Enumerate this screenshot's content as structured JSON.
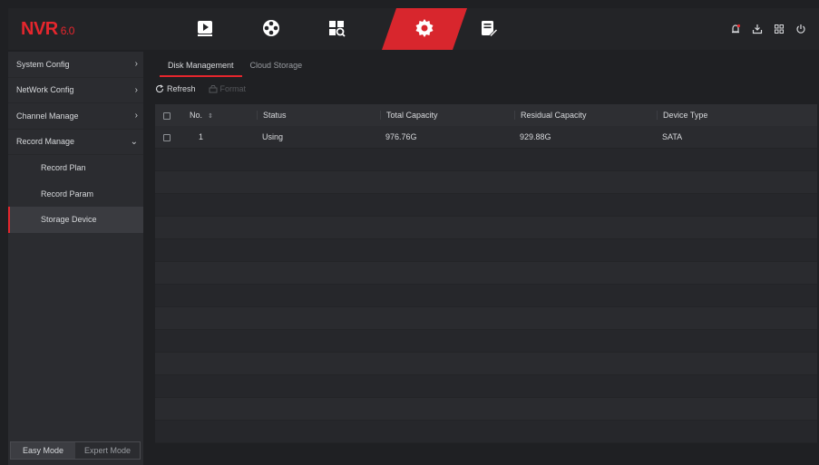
{
  "app": {
    "logo": "NVR",
    "version": "6.0"
  },
  "nav": {
    "icons": [
      "playback-icon",
      "live-view-icon",
      "search-icon",
      "settings-icon",
      "maintenance-icon"
    ],
    "active": "settings-icon"
  },
  "top_right_icons": [
    "alarm-icon",
    "download-icon",
    "grid-icon",
    "power-icon"
  ],
  "sidebar": {
    "items": [
      {
        "label": "System Config",
        "chevron": "›"
      },
      {
        "label": "NetWork Config",
        "chevron": "›"
      },
      {
        "label": "Channel Manage",
        "chevron": "›"
      },
      {
        "label": "Record Manage",
        "chevron": "⌄"
      }
    ],
    "subitems": [
      {
        "label": "Record Plan"
      },
      {
        "label": "Record Param"
      },
      {
        "label": "Storage Device"
      }
    ],
    "active_subitem": "Storage Device",
    "modes": {
      "easy": "Easy Mode",
      "expert": "Expert Mode",
      "selected": "Easy Mode"
    }
  },
  "tabs": [
    {
      "label": "Disk Management",
      "active": true
    },
    {
      "label": "Cloud Storage",
      "active": false
    }
  ],
  "toolbar": {
    "refresh": "Refresh",
    "format": "Format"
  },
  "table": {
    "headers": {
      "no": "No.",
      "status": "Status",
      "total": "Total Capacity",
      "residual": "Residual Capacity",
      "type": "Device Type"
    },
    "rows": [
      {
        "no": "1",
        "status": "Using",
        "total": "976.76G",
        "residual": "929.88G",
        "type": "SATA"
      }
    ]
  },
  "colors": {
    "accent": "#e5262d",
    "background": "#1f2023",
    "sidebar": "#2b2c30"
  }
}
